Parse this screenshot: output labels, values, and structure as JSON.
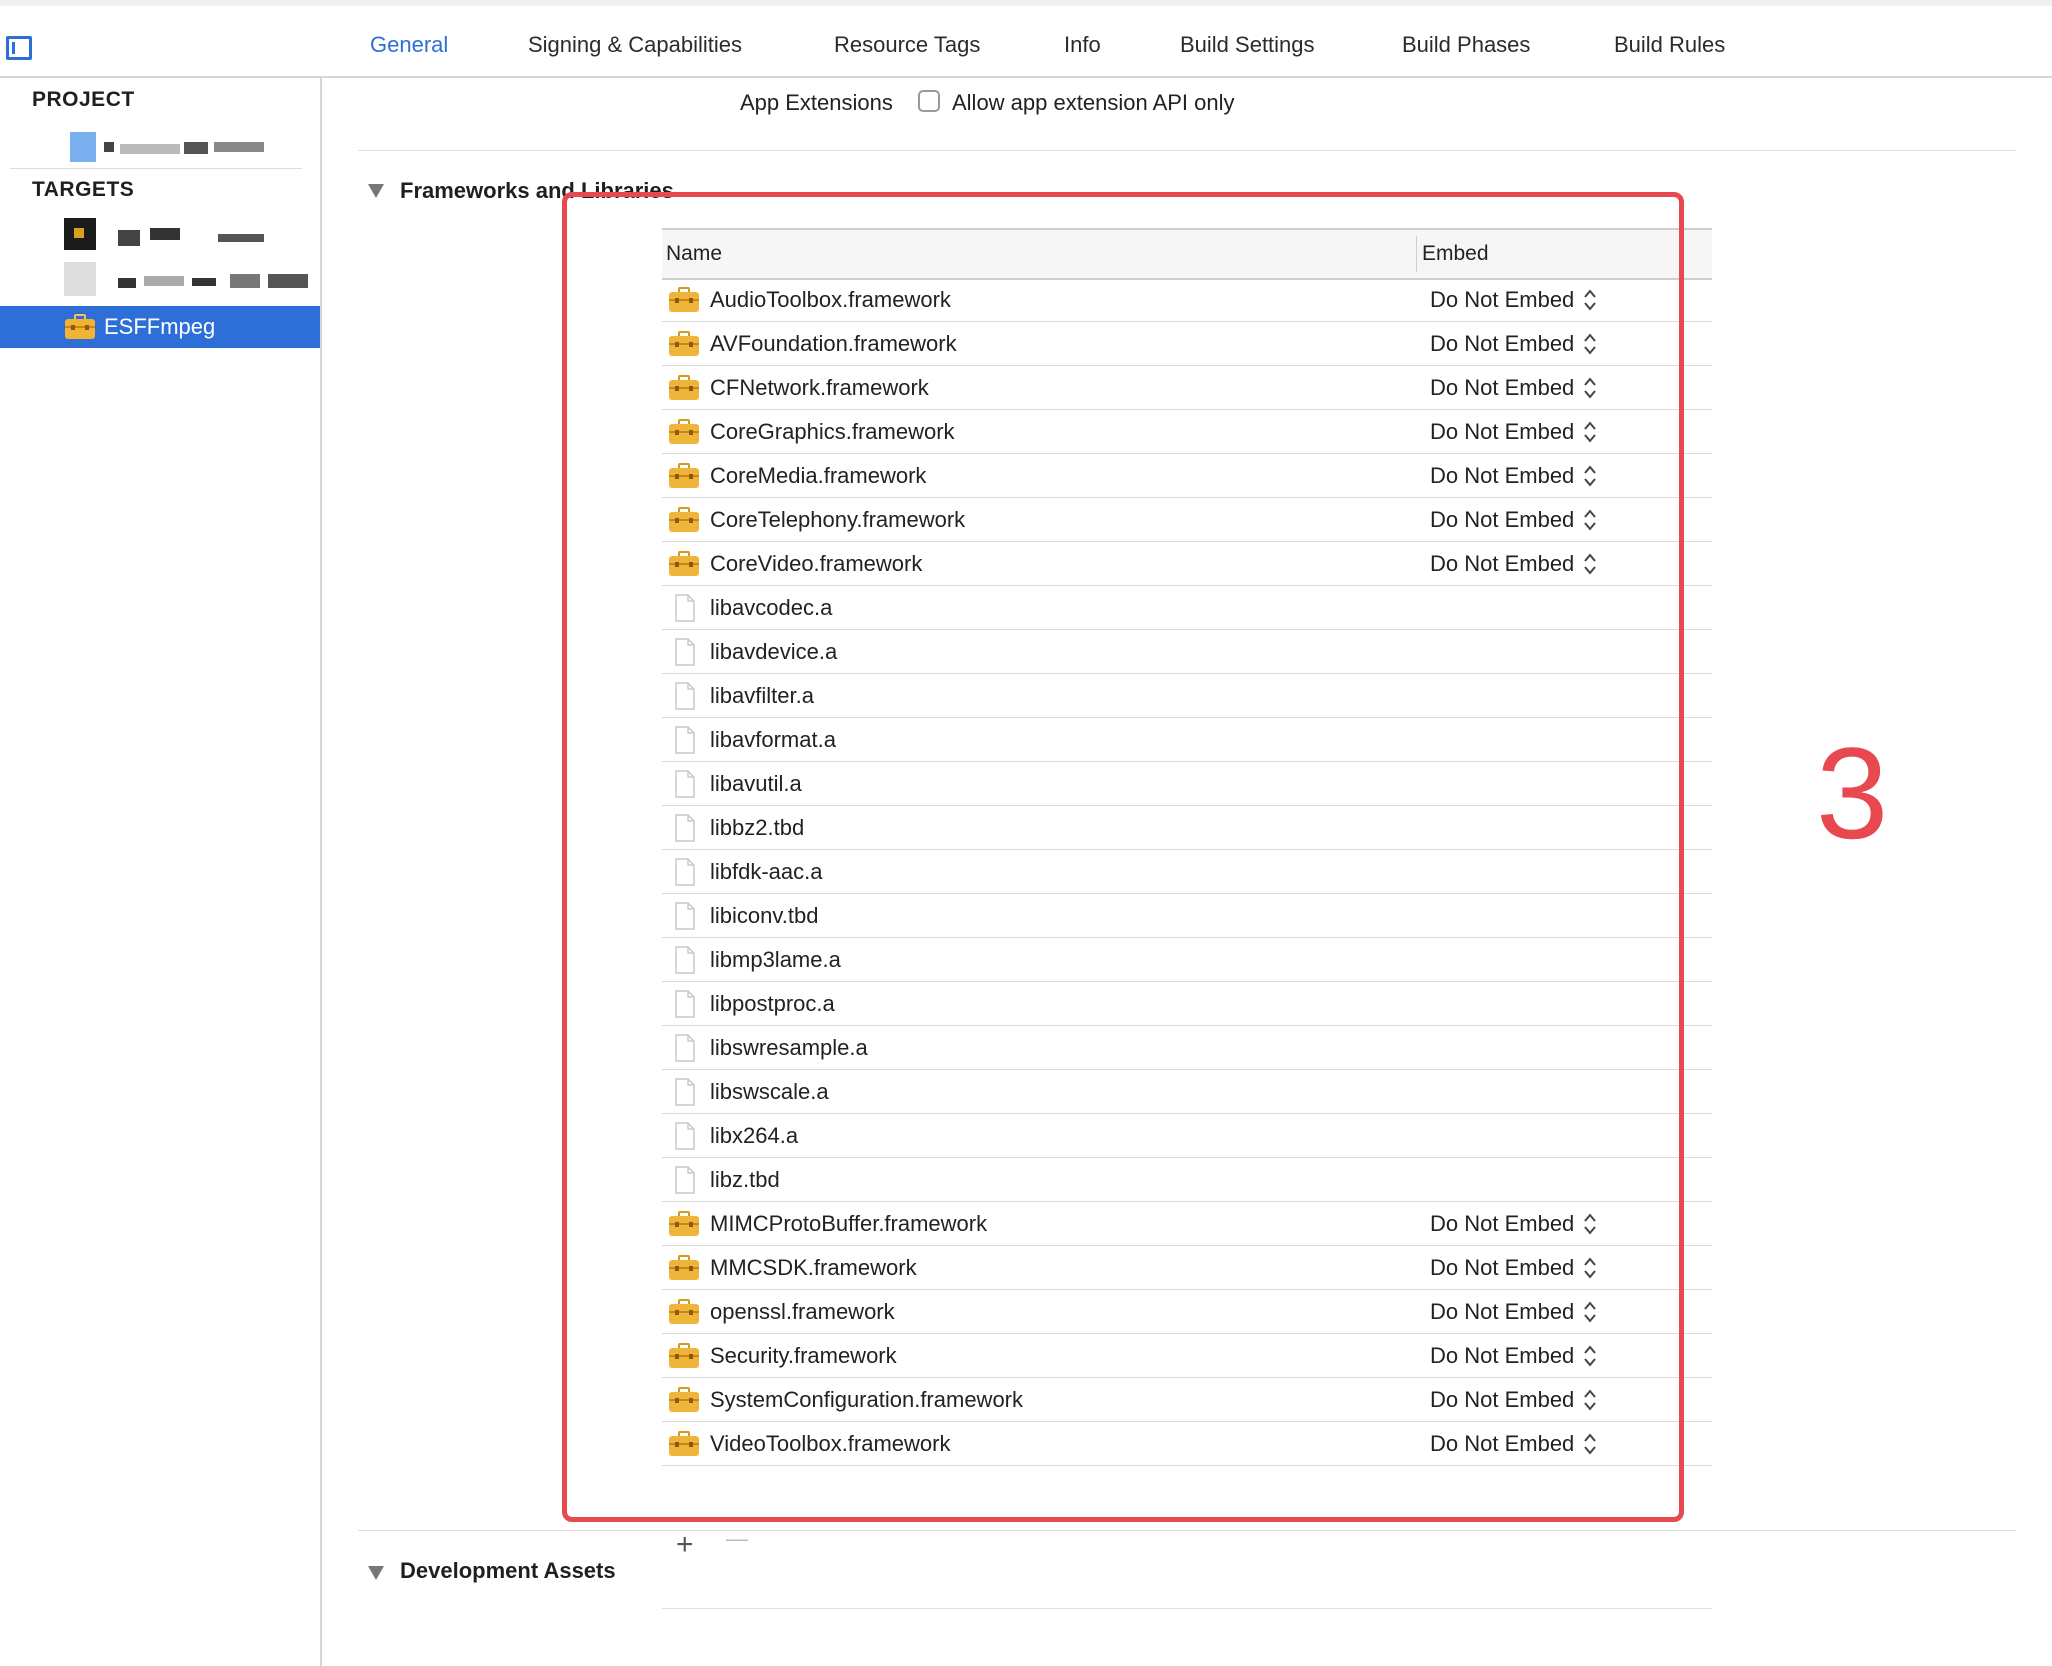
{
  "tabs": [
    {
      "label": "General",
      "active": true
    },
    {
      "label": "Signing & Capabilities",
      "active": false
    },
    {
      "label": "Resource Tags",
      "active": false
    },
    {
      "label": "Info",
      "active": false
    },
    {
      "label": "Build Settings",
      "active": false
    },
    {
      "label": "Build Phases",
      "active": false
    },
    {
      "label": "Build Rules",
      "active": false
    }
  ],
  "navigator": {
    "project_heading": "PROJECT",
    "targets_heading": "TARGETS",
    "selected_target": "ESFFmpeg"
  },
  "app_extensions": {
    "label": "App Extensions",
    "checkbox_label": "Allow app extension API only",
    "checked": false
  },
  "frameworks_section": {
    "title": "Frameworks and Libraries",
    "col_name": "Name",
    "col_embed": "Embed",
    "rows": [
      {
        "name": "AudioToolbox.framework",
        "kind": "framework",
        "embed": "Do Not Embed"
      },
      {
        "name": "AVFoundation.framework",
        "kind": "framework",
        "embed": "Do Not Embed"
      },
      {
        "name": "CFNetwork.framework",
        "kind": "framework",
        "embed": "Do Not Embed"
      },
      {
        "name": "CoreGraphics.framework",
        "kind": "framework",
        "embed": "Do Not Embed"
      },
      {
        "name": "CoreMedia.framework",
        "kind": "framework",
        "embed": "Do Not Embed"
      },
      {
        "name": "CoreTelephony.framework",
        "kind": "framework",
        "embed": "Do Not Embed"
      },
      {
        "name": "CoreVideo.framework",
        "kind": "framework",
        "embed": "Do Not Embed"
      },
      {
        "name": "libavcodec.a",
        "kind": "file",
        "embed": ""
      },
      {
        "name": "libavdevice.a",
        "kind": "file",
        "embed": ""
      },
      {
        "name": "libavfilter.a",
        "kind": "file",
        "embed": ""
      },
      {
        "name": "libavformat.a",
        "kind": "file",
        "embed": ""
      },
      {
        "name": "libavutil.a",
        "kind": "file",
        "embed": ""
      },
      {
        "name": "libbz2.tbd",
        "kind": "file",
        "embed": ""
      },
      {
        "name": "libfdk-aac.a",
        "kind": "file",
        "embed": ""
      },
      {
        "name": "libiconv.tbd",
        "kind": "file",
        "embed": ""
      },
      {
        "name": "libmp3lame.a",
        "kind": "file",
        "embed": ""
      },
      {
        "name": "libpostproc.a",
        "kind": "file",
        "embed": ""
      },
      {
        "name": "libswresample.a",
        "kind": "file",
        "embed": ""
      },
      {
        "name": "libswscale.a",
        "kind": "file",
        "embed": ""
      },
      {
        "name": "libx264.a",
        "kind": "file",
        "embed": ""
      },
      {
        "name": "libz.tbd",
        "kind": "file",
        "embed": ""
      },
      {
        "name": "MIMCProtoBuffer.framework",
        "kind": "framework",
        "embed": "Do Not Embed"
      },
      {
        "name": "MMCSDK.framework",
        "kind": "framework",
        "embed": "Do Not Embed"
      },
      {
        "name": "openssl.framework",
        "kind": "framework",
        "embed": "Do Not Embed"
      },
      {
        "name": "Security.framework",
        "kind": "framework",
        "embed": "Do Not Embed"
      },
      {
        "name": "SystemConfiguration.framework",
        "kind": "framework",
        "embed": "Do Not Embed"
      },
      {
        "name": "VideoToolbox.framework",
        "kind": "framework",
        "embed": "Do Not Embed"
      }
    ],
    "add_symbol": "+",
    "remove_symbol": "—"
  },
  "development_assets_title": "Development Assets",
  "annotation": {
    "number": "3",
    "color": "#e8484f"
  },
  "colors": {
    "accent": "#2d6fd6",
    "folder": "#e8a92a"
  }
}
